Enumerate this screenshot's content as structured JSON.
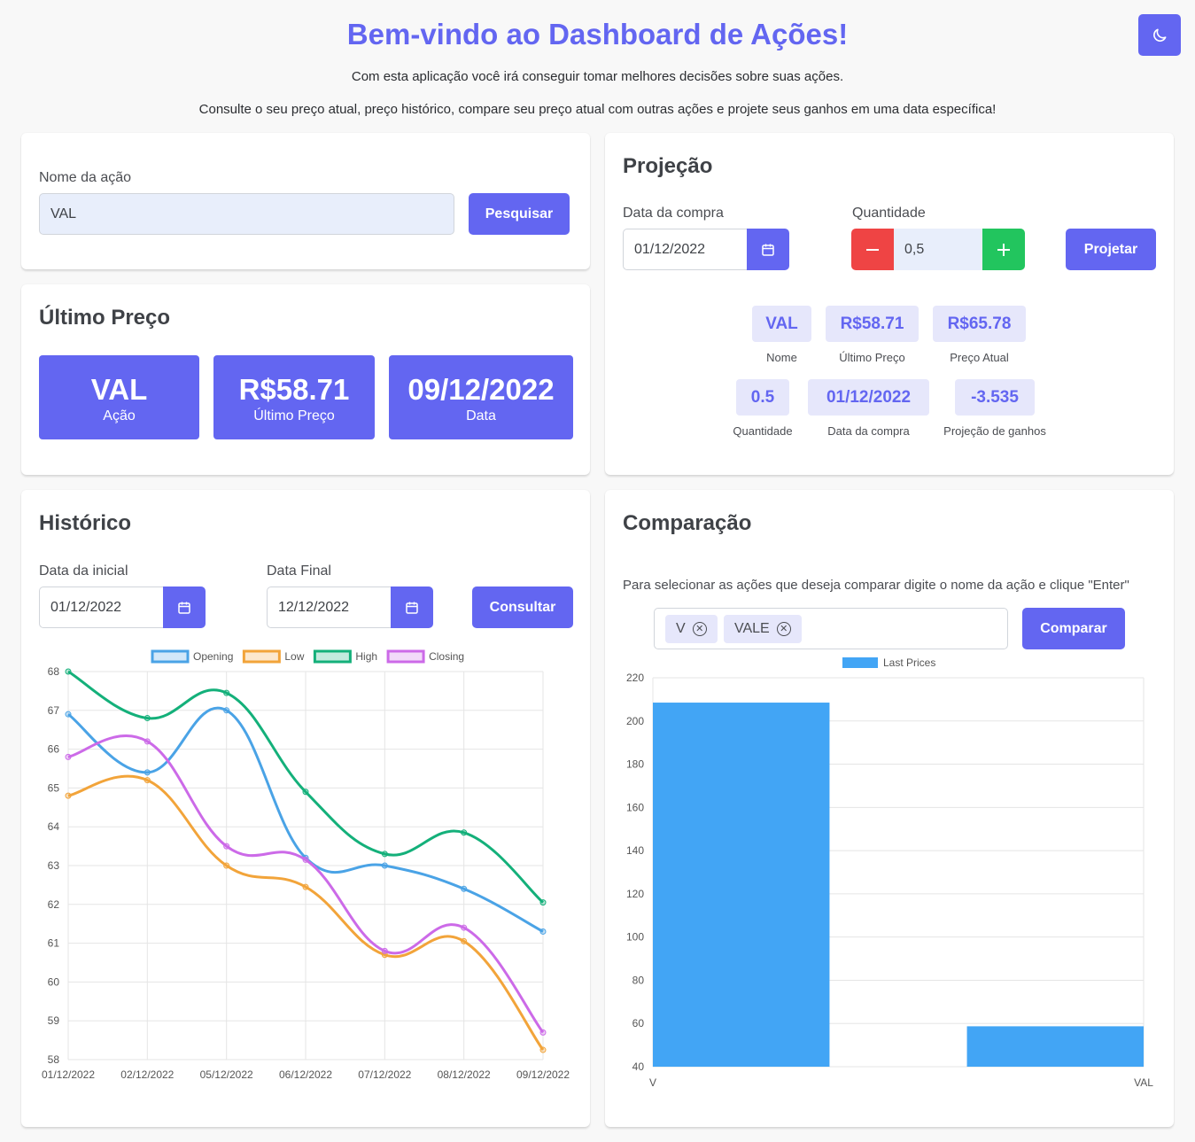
{
  "header": {
    "title": "Bem-vindo ao Dashboard de Ações!",
    "subtitle1": "Com esta aplicação você irá conseguir tomar melhores decisões sobre suas ações.",
    "subtitle2": "Consulte o seu preço atual, preço histórico, compare seu preço atual com outras ações e projete seus ganhos em uma data específica!",
    "theme_icon": "moon-icon"
  },
  "search": {
    "label": "Nome da ação",
    "value": "VAL",
    "button": "Pesquisar"
  },
  "last_price": {
    "title": "Último Preço",
    "cards": [
      {
        "value": "VAL",
        "label": "Ação"
      },
      {
        "value": "R$58.71",
        "label": "Último Preço"
      },
      {
        "value": "09/12/2022",
        "label": "Data"
      }
    ]
  },
  "projection": {
    "title": "Projeção",
    "date_label": "Data da compra",
    "date_value": "01/12/2022",
    "qty_label": "Quantidade",
    "qty_value": "0,5",
    "button": "Projetar",
    "results_row1": [
      {
        "value": "VAL",
        "label": "Nome"
      },
      {
        "value": "R$58.71",
        "label": "Último Preço"
      },
      {
        "value": "R$65.78",
        "label": "Preço Atual"
      }
    ],
    "results_row2": [
      {
        "value": "0.5",
        "label": "Quantidade"
      },
      {
        "value": "01/12/2022",
        "label": "Data da compra"
      },
      {
        "value": "-3.535",
        "label": "Projeção de ganhos"
      }
    ]
  },
  "history": {
    "title": "Histórico",
    "start_label": "Data da inicial",
    "start_value": "01/12/2022",
    "end_label": "Data Final",
    "end_value": "12/12/2022",
    "button": "Consultar"
  },
  "comparison": {
    "title": "Comparação",
    "hint": "Para selecionar as ações que deseja comparar digite o nome da ação e clique \"Enter\"",
    "tags": [
      "V",
      "VALE"
    ],
    "button": "Comparar"
  },
  "colors": {
    "accent": "#6366f1",
    "opening": "#4aa3e6",
    "low": "#f2a43a",
    "high": "#14b07a",
    "closing": "#cc6ae8",
    "bar": "#42a5f5"
  },
  "chart_data": [
    {
      "type": "line",
      "categories": [
        "01/12/2022",
        "02/12/2022",
        "05/12/2022",
        "06/12/2022",
        "07/12/2022",
        "08/12/2022",
        "09/12/2022"
      ],
      "ylim": [
        58,
        68
      ],
      "yticks": [
        58,
        59,
        60,
        61,
        62,
        63,
        64,
        65,
        66,
        67,
        68
      ],
      "legend": "top",
      "grid": true,
      "series": [
        {
          "name": "Opening",
          "values": [
            66.9,
            65.4,
            67.0,
            63.2,
            63.0,
            62.4,
            61.3
          ]
        },
        {
          "name": "Low",
          "values": [
            64.8,
            65.2,
            63.0,
            62.45,
            60.7,
            61.05,
            58.25
          ]
        },
        {
          "name": "High",
          "values": [
            68.0,
            66.8,
            67.45,
            64.9,
            63.3,
            63.85,
            62.05
          ]
        },
        {
          "name": "Closing",
          "values": [
            65.8,
            66.2,
            63.5,
            63.15,
            60.8,
            61.4,
            58.7
          ]
        }
      ]
    },
    {
      "type": "bar",
      "categories": [
        "V",
        "VAL"
      ],
      "ylim": [
        40,
        220
      ],
      "yticks": [
        40,
        60,
        80,
        100,
        120,
        140,
        160,
        180,
        200,
        220
      ],
      "legend": "top",
      "grid": true,
      "series": [
        {
          "name": "Last Prices",
          "values": [
            208.5,
            58.7
          ]
        }
      ]
    }
  ]
}
